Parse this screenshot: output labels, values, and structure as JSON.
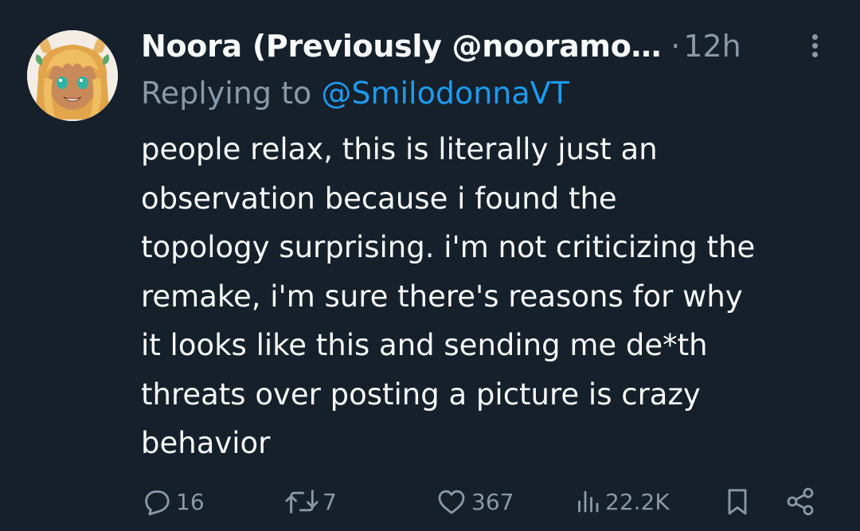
{
  "tweet": {
    "display_name": "Noora (Previously @nooramo…",
    "separator": "·",
    "time": "12h",
    "replying_to_prefix": "Replying to",
    "replying_to_handle": "@SmilodonnaVT",
    "text_lines": [
      "people relax, this is literally just an",
      "observation because i found the",
      "topology surprising. i'm not criticizing the",
      "remake, i'm sure there's reasons for why",
      "it looks like this and sending me de*th",
      "threats over posting a picture is crazy",
      "behavior"
    ]
  },
  "actions": {
    "replies": "16",
    "reposts": "7",
    "likes": "367",
    "views": "22.2K"
  },
  "colors": {
    "background": "#15202b",
    "text": "#f7f9f9",
    "secondary": "#8b98a5",
    "link": "#1d9bf0"
  },
  "icons": [
    "more-icon",
    "reply-icon",
    "repost-icon",
    "like-icon",
    "views-icon",
    "bookmark-icon",
    "share-icon"
  ]
}
